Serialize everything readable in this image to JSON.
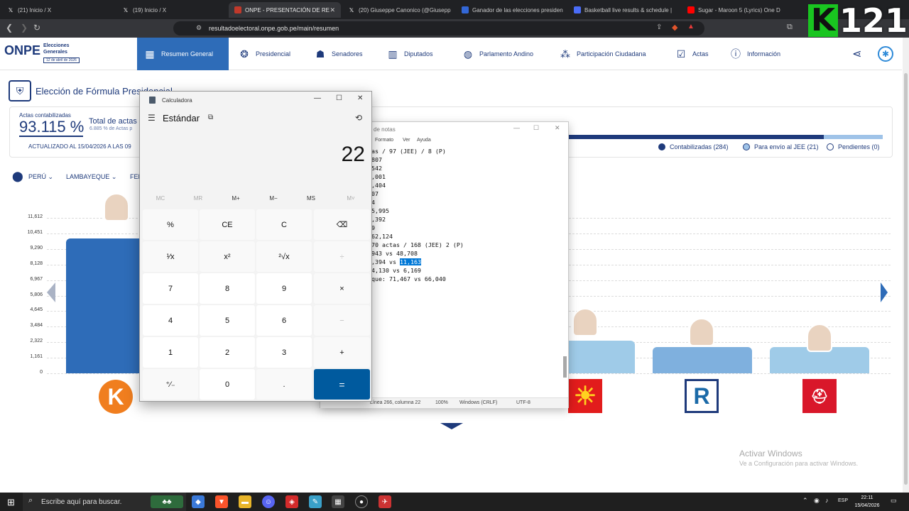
{
  "browser": {
    "tabs": [
      {
        "label": "(21) Inicio / X",
        "icon": "X",
        "active": false
      },
      {
        "label": "(19) Inicio / X",
        "icon": "X",
        "active": false
      },
      {
        "label": "ONPE - PRESENTACIÓN DE RE",
        "icon": "onpe",
        "active": true
      },
      {
        "label": "(20) Giuseppe Canonico (@Giusepp",
        "icon": "X",
        "active": false
      },
      {
        "label": "Ganador de las elecciones presiden",
        "icon": "G",
        "active": false
      },
      {
        "label": "Basketball live results & schedule |",
        "icon": "B",
        "active": false
      },
      {
        "label": "Sugar - Maroon 5 (Lyrics) One D",
        "icon": "YT",
        "active": false
      }
    ],
    "url": "resultadoelectoral.onpe.gob.pe/main/resumen"
  },
  "overlay_logo": {
    "letter": "K",
    "number": "121"
  },
  "onpe": {
    "logo": "ONPE",
    "subtitle_1": "Elecciones",
    "subtitle_2": "Generales",
    "date_badge": "12 de abril de 2026",
    "nav": [
      {
        "label": "Resumen General",
        "icon": "grid-icon"
      },
      {
        "label": "Presidencial",
        "icon": "seal-icon"
      },
      {
        "label": "Senadores",
        "icon": "people-icon"
      },
      {
        "label": "Diputados",
        "icon": "building-icon"
      },
      {
        "label": "Parlamento Andino",
        "icon": "globe-icon"
      },
      {
        "label": "Participación Ciudadana",
        "icon": "group-icon"
      },
      {
        "label": "Actas",
        "icon": "check-icon"
      },
      {
        "label": "Información",
        "icon": "info-icon"
      }
    ],
    "page_title": "Elección de Fórmula Presidencial",
    "actas_label": "Actas contabilizadas",
    "actas_pct": "93.115 %",
    "total_actas": "Total de actas",
    "total_sub": "6.885 % de Actas p",
    "updated": "ACTUALIZADO AL 15/04/2026 A LAS 09",
    "progress_fraction": 0.812,
    "legend": [
      {
        "label": "Contabilizadas (284)",
        "color": "#1e3a7b"
      },
      {
        "label": "Para envío al JEE (21)",
        "color": "#9fc3e8"
      },
      {
        "label": "Pendientes (0)",
        "color": "#ffffff"
      }
    ],
    "breadcrumb": [
      "PERÚ",
      "LAMBAYEQUE",
      "FER"
    ],
    "activate_title": "Activar Windows",
    "activate_sub": "Ve a Configuración para activar Windows."
  },
  "chart_data": {
    "type": "bar",
    "yticks": [
      "11,612",
      "10,451",
      "9,290",
      "8,128",
      "6,967",
      "5,806",
      "4,645",
      "3,484",
      "2,322",
      "1,161",
      "0"
    ],
    "ylim": [
      0,
      11612
    ],
    "bars": [
      {
        "value": 10100,
        "color": "#2e6cb8"
      },
      {
        "value": 0,
        "color": "#2e6cb8"
      },
      {
        "value": 0,
        "color": "#2e6cb8"
      },
      {
        "value": 2450,
        "color": "#9fcbe8"
      },
      {
        "value": 1950,
        "color": "#7fb0de"
      },
      {
        "value": 1950,
        "color": "#9fcbe8"
      }
    ]
  },
  "notepad": {
    "title": "de notas",
    "menu": [
      "Formato",
      "Ver",
      "Ayuda"
    ],
    "lines": [
      "as / 97 (JEE) / 8 (P)",
      "",
      "807",
      "542",
      ",001",
      ",404",
      "07",
      "",
      "4",
      "",
      "",
      "",
      "5,995",
      "",
      ",392",
      "9",
      "",
      "62,124",
      "",
      "",
      "70 actas / 168 (JEE) 2 (P)",
      "",
      "943 vs 48,708",
      ",394 vs ",
      "4,130 vs 6,169",
      "",
      "que: 71,467 vs 66,040"
    ],
    "highlight": "11,163",
    "status": [
      "Línea 266, columna 22",
      "100%",
      "Windows (CRLF)",
      "UTF-8"
    ]
  },
  "calculator": {
    "title": "Calculadora",
    "mode": "Estándar",
    "display": "22",
    "memory": [
      "MC",
      "MR",
      "M+",
      "M−",
      "MS",
      "M˅"
    ],
    "keys": [
      "%",
      "CE",
      "C",
      "⌫",
      "¹⁄x",
      "x²",
      "²√x",
      "÷",
      "7",
      "8",
      "9",
      "×",
      "4",
      "5",
      "6",
      "−",
      "1",
      "2",
      "3",
      "+",
      "⁺⁄₋",
      "0",
      ".",
      "="
    ]
  },
  "taskbar": {
    "search_placeholder": "Escribe aquí para buscar.",
    "lang": "ESP",
    "time": "22:11",
    "date": "15/04/2026"
  }
}
